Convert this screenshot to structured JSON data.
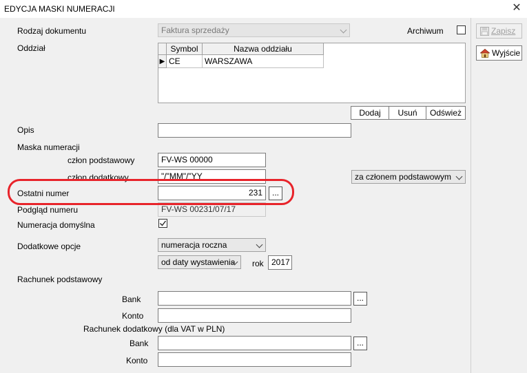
{
  "window": {
    "title": "EDYCJA MASKI NUMERACJI"
  },
  "rodzaj": {
    "label": "Rodzaj dokumentu",
    "value": "Faktura sprzedaży"
  },
  "archiwum": {
    "label": "Archiwum",
    "checked": false
  },
  "oddzial": {
    "label": "Oddział",
    "columns": [
      "Symbol",
      "Nazwa oddziału"
    ],
    "rows": [
      {
        "symbol": "CE",
        "name": "WARSZAWA"
      }
    ],
    "buttons": {
      "add": "Dodaj",
      "remove": "Usuń",
      "refresh": "Odśwież"
    }
  },
  "opis": {
    "label": "Opis",
    "value": ""
  },
  "maska": {
    "label": "Maska numeracji",
    "podstawowy_label": "człon podstawowy",
    "podstawowy_value": "FV-WS 00000",
    "dodatkowy_label": "człon dodatkowy",
    "dodatkowy_value": "\"/\"MM\"/\"YY",
    "dodatkowy_mode": "za członem podstawowym"
  },
  "ostatni": {
    "label": "Ostatni numer",
    "value": "231",
    "button": "..."
  },
  "podglad": {
    "label": "Podgląd numeru",
    "value": "FV-WS 00231/07/17"
  },
  "domyslna": {
    "label": "Numeracja domyślna",
    "checked": true
  },
  "opcje": {
    "label": "Dodatkowe opcje",
    "numeracja": "numeracja roczna",
    "od_daty": "od daty wystawienia",
    "rok_label": "rok",
    "rok_value": "2017"
  },
  "rachunek_podst": {
    "label": "Rachunek podstawowy",
    "bank_label": "Bank",
    "konto_label": "Konto",
    "bank_value": "",
    "konto_value": "",
    "button": "..."
  },
  "rachunek_dod": {
    "label": "Rachunek dodatkowy (dla VAT w PLN)",
    "bank_label": "Bank",
    "konto_label": "Konto",
    "bank_value": "",
    "konto_value": "",
    "button": "..."
  },
  "sidebar": {
    "save": "Zapisz",
    "exit": "Wyjście"
  },
  "colors": {
    "highlight": "#e8232a",
    "panel": "#f0f0f0"
  }
}
